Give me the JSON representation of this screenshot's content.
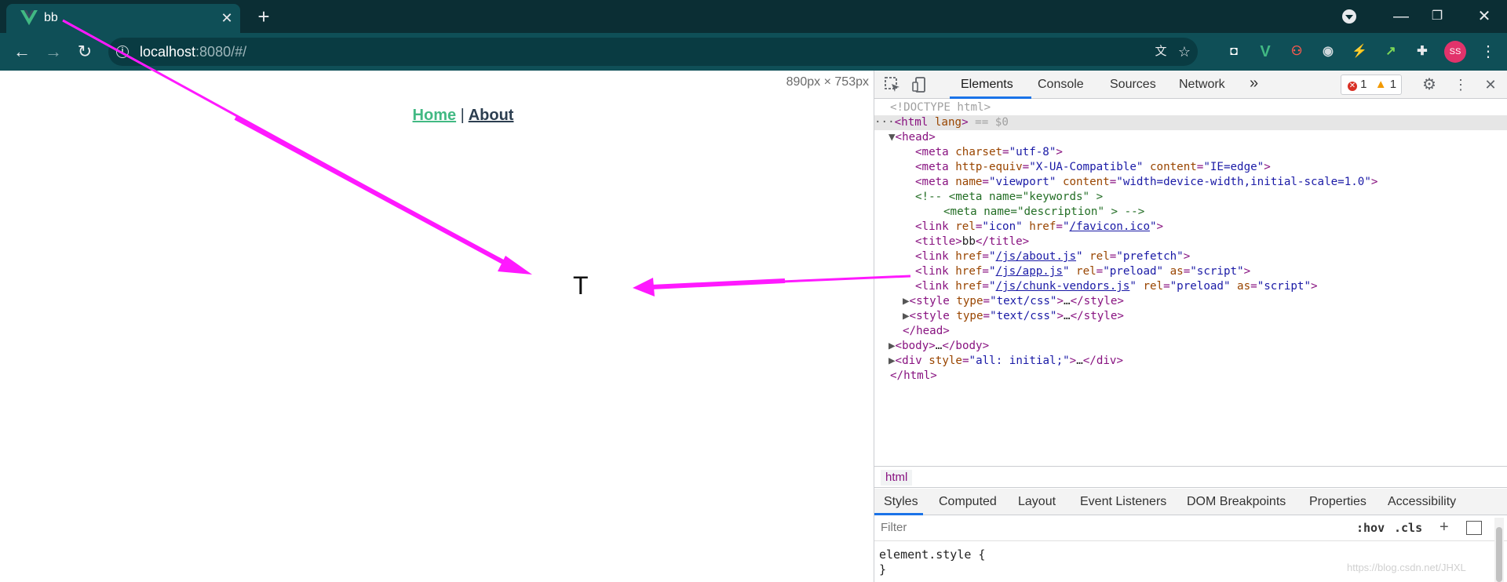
{
  "browser": {
    "tab": {
      "title": "bb",
      "favicon": "vue-logo-icon"
    },
    "url_host": "localhost",
    "url_rest": ":8080/#/",
    "avatar_initials": "SS",
    "colors": {
      "tabstrip": "#0b2e34",
      "toolbar": "#0f4f57",
      "avatar": "#e2336b"
    }
  },
  "page": {
    "dimensions": "890px × 753px",
    "nav": {
      "home": "Home",
      "separator": "|",
      "about": "About"
    },
    "content_char": "T",
    "colors": {
      "active_link": "#42b983",
      "link": "#2c3e50"
    }
  },
  "devtools": {
    "tabs": [
      "Elements",
      "Console",
      "Sources",
      "Network"
    ],
    "more_tabs": "»",
    "issues": {
      "errors": "1",
      "warnings": "1"
    },
    "dom": {
      "doctype": "<!DOCTYPE html>",
      "html_open_tag": "html",
      "html_open_attr": "lang",
      "selected_marker": "== $0",
      "head_open": "<head>",
      "meta_charset_val": "\"utf-8\"",
      "meta_httpequiv_val": "\"X-UA-Compatible\"",
      "meta_content_edge": "\"IE=edge\"",
      "meta_name_viewport": "\"viewport\"",
      "meta_content_viewport": "\"width=device-width,initial-scale=1.0\"",
      "comment_line1": "<!-- <meta name=\"keywords\" >",
      "comment_line2": "<meta name=\"description\" > -->",
      "link_icon_rel": "\"icon\"",
      "link_icon_href": "/favicon.ico",
      "title_text": "bb",
      "link1_href": "/js/about.js",
      "link1_rel": "\"prefetch\"",
      "link2_href": "/js/app.js",
      "link2_rel": "\"preload\"",
      "link2_as": "\"script\"",
      "link3_href": "/js/chunk-vendors.js",
      "link3_rel": "\"preload\"",
      "link3_as": "\"script\"",
      "style_type": "\"text/css\"",
      "ellipsis": "…",
      "div_style_val": "\"all: initial;\""
    },
    "breadcrumb": "html",
    "styles_tabs": [
      "Styles",
      "Computed",
      "Layout",
      "Event Listeners",
      "DOM Breakpoints",
      "Properties",
      "Accessibility"
    ],
    "filter_placeholder": "Filter",
    "hov": ":hov",
    "cls": ".cls",
    "element_style": "element.style {",
    "element_style_close": "}",
    "watermark": "https://blog.csdn.net/JHXL"
  }
}
